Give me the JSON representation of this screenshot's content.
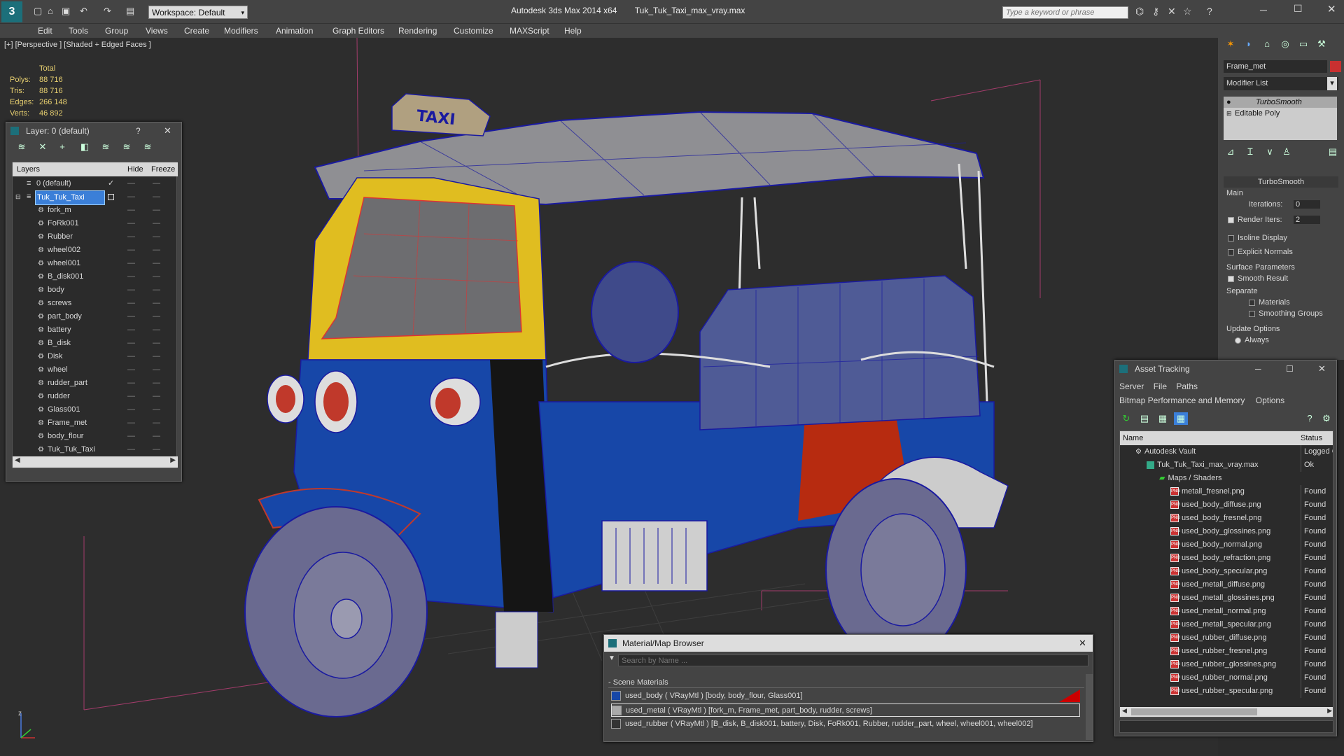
{
  "app": {
    "title": "Autodesk 3ds Max  2014 x64",
    "file": "Tuk_Tuk_Taxi_max_vray.max",
    "workspace": "Workspace: Default",
    "search_placeholder": "Type a keyword or phrase"
  },
  "menu": [
    "Edit",
    "Tools",
    "Group",
    "Views",
    "Create",
    "Modifiers",
    "Animation",
    "Graph Editors",
    "Rendering",
    "Customize",
    "MAXScript",
    "Help"
  ],
  "viewport": {
    "label": "[+] [Perspective ] [Shaded + Edged Faces ]",
    "stats_header": "Total",
    "stats": [
      {
        "label": "Polys:",
        "value": "88 716"
      },
      {
        "label": "Tris:",
        "value": "88 716"
      },
      {
        "label": "Edges:",
        "value": "266 148"
      },
      {
        "label": "Verts:",
        "value": "46 892"
      }
    ],
    "axis_z": "z"
  },
  "layer_dialog": {
    "title": "Layer: 0 (default)",
    "help": "?",
    "col_layers": "Layers",
    "col_hide": "Hide",
    "col_freeze": "Freeze",
    "layers": [
      "0 (default)",
      "Tuk_Tuk_Taxi"
    ],
    "objects": [
      "fork_m",
      "FoRk001",
      "Rubber",
      "wheel002",
      "wheel001",
      "B_disk001",
      "body",
      "screws",
      "part_body",
      "battery",
      "B_disk",
      "Disk",
      "wheel",
      "rudder_part",
      "rudder",
      "Glass001",
      "Frame_met",
      "body_flour",
      "Tuk_Tuk_Taxi"
    ]
  },
  "command_panel": {
    "object_name": "Frame_met",
    "modifier_list": "Modifier List",
    "stack": [
      "TurboSmooth",
      "Editable Poly"
    ],
    "rollout_title": "TurboSmooth",
    "main": "Main",
    "iterations_label": "Iterations:",
    "iterations_value": "0",
    "render_iters_label": "Render Iters:",
    "render_iters_value": "2",
    "isoline": "Isoline Display",
    "explicit": "Explicit Normals",
    "surface_params": "Surface Parameters",
    "smooth_result": "Smooth Result",
    "separate": "Separate",
    "materials": "Materials",
    "smoothing_groups": "Smoothing Groups",
    "update_options": "Update Options",
    "always": "Always"
  },
  "asset_tracking": {
    "title": "Asset Tracking",
    "menu1": [
      "Server",
      "File",
      "Paths"
    ],
    "menu2": [
      "Bitmap Performance and Memory",
      "Options"
    ],
    "col_name": "Name",
    "col_status": "Status",
    "rows": [
      {
        "name": "Autodesk Vault",
        "status": "Logged C",
        "level": 1
      },
      {
        "name": "Tuk_Tuk_Taxi_max_vray.max",
        "status": "Ok",
        "level": 2
      },
      {
        "name": "Maps / Shaders",
        "status": "",
        "level": 3
      },
      {
        "name": "metall_fresnel.png",
        "status": "Found",
        "level": 4
      },
      {
        "name": "used_body_diffuse.png",
        "status": "Found",
        "level": 4
      },
      {
        "name": "used_body_fresnel.png",
        "status": "Found",
        "level": 4
      },
      {
        "name": "used_body_glossines.png",
        "status": "Found",
        "level": 4
      },
      {
        "name": "used_body_normal.png",
        "status": "Found",
        "level": 4
      },
      {
        "name": "used_body_refraction.png",
        "status": "Found",
        "level": 4
      },
      {
        "name": "used_body_specular.png",
        "status": "Found",
        "level": 4
      },
      {
        "name": "used_metall_diffuse.png",
        "status": "Found",
        "level": 4
      },
      {
        "name": "used_metall_glossines.png",
        "status": "Found",
        "level": 4
      },
      {
        "name": "used_metall_normal.png",
        "status": "Found",
        "level": 4
      },
      {
        "name": "used_metall_specular.png",
        "status": "Found",
        "level": 4
      },
      {
        "name": "used_rubber_diffuse.png",
        "status": "Found",
        "level": 4
      },
      {
        "name": "used_rubber_fresnel.png",
        "status": "Found",
        "level": 4
      },
      {
        "name": "used_rubber_glossines.png",
        "status": "Found",
        "level": 4
      },
      {
        "name": "used_rubber_normal.png",
        "status": "Found",
        "level": 4
      },
      {
        "name": "used_rubber_specular.png",
        "status": "Found",
        "level": 4
      }
    ]
  },
  "material_browser": {
    "title": "Material/Map Browser",
    "search_placeholder": "Search by Name ...",
    "group": "- Scene Materials",
    "items": [
      "used_body  ( VRayMtl ) [body, body_flour, Glass001]",
      "used_metal  ( VRayMtl ) [fork_m, Frame_met, part_body, rudder, screws]",
      "used_rubber  ( VRayMtl ) [B_disk, B_disk001, battery, Disk, FoRk001, Rubber, rudder_part, wheel, wheel001, wheel002]"
    ]
  },
  "taxi_sign": "TAXI",
  "colors": {
    "accent": "#3a78d8",
    "body_blue": "#1747a8",
    "yellow": "#e6c21c",
    "wire": "#1a1aa0",
    "selected": "#3b7fd8"
  }
}
